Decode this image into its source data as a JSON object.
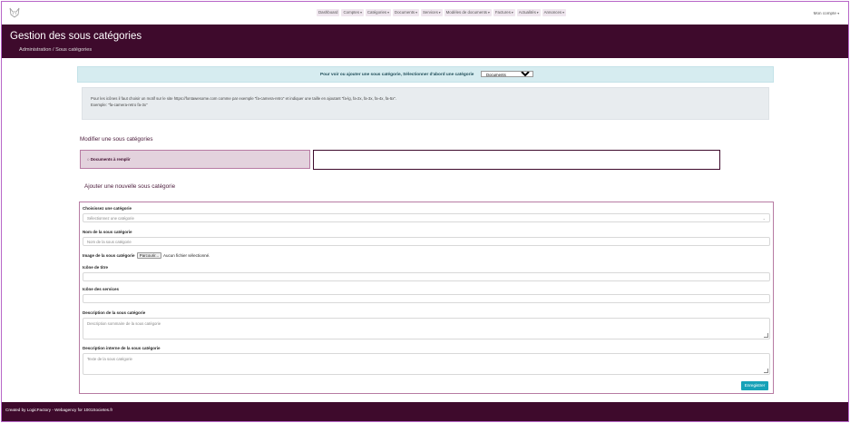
{
  "nav": {
    "logo_icon": "fox-logo-icon",
    "menu": [
      "Dashboard",
      "Comptes",
      "Catégories",
      "Documents",
      "Services",
      "Modèles de documents",
      "Factures",
      "Actualités",
      "Annonces"
    ],
    "account": "Mon compte"
  },
  "header": {
    "title": "Gestion des sous catégories",
    "breadcrumb": "Administration / Sous catégories"
  },
  "alert": {
    "text": "Pour voir ou ajouter une sous catégorie, Sélectionner d'abord une catégorie",
    "selected_category": "Documents"
  },
  "note": {
    "line1": "Pour les icônes il faut choisir un motif sur le site https://fontawesome.com comme par exemple \"fa-camera-retro\" et indiquer une taille en ajoutant \"fa-lg, fa-2x, fa-3x, fa-4x, fa-5x\".",
    "line2": "Exemple: \"fa-camera-retro fa-3x\""
  },
  "edit_section": {
    "title": "Modifier une sous catégories",
    "items": [
      "Documents à remplir"
    ]
  },
  "add_section": {
    "title": "Ajouter une nouvelle sous catégorie",
    "category_label": "Choisissez une catégorie",
    "category_placeholder": "Sélectionnez une catégorie",
    "name_label": "Nom de la sous catégorie",
    "name_placeholder": "Nom de la sous catégorie",
    "image_label": "Image de la sous catégorie",
    "browse_label": "Parcourir...",
    "no_file": "Aucun fichier sélectionné.",
    "title_icon_label": "Icône de titre",
    "services_icon_label": "Icône des services",
    "description_label": "Description de la sous catégorie",
    "description_placeholder": "Description sommaire de la sous catégorie",
    "internal_description_label": "Description interne de la sous catégorie",
    "internal_description_placeholder": "Texte de la sous catégorie",
    "save_label": "Enregistrer"
  },
  "footer": {
    "text": "Created by LogicFactory - Webagency for 1001Societes.fr"
  },
  "colors": {
    "brand": "#3e0a2c",
    "info_bg": "#d6ecf0",
    "save_button": "#17a2b8"
  }
}
